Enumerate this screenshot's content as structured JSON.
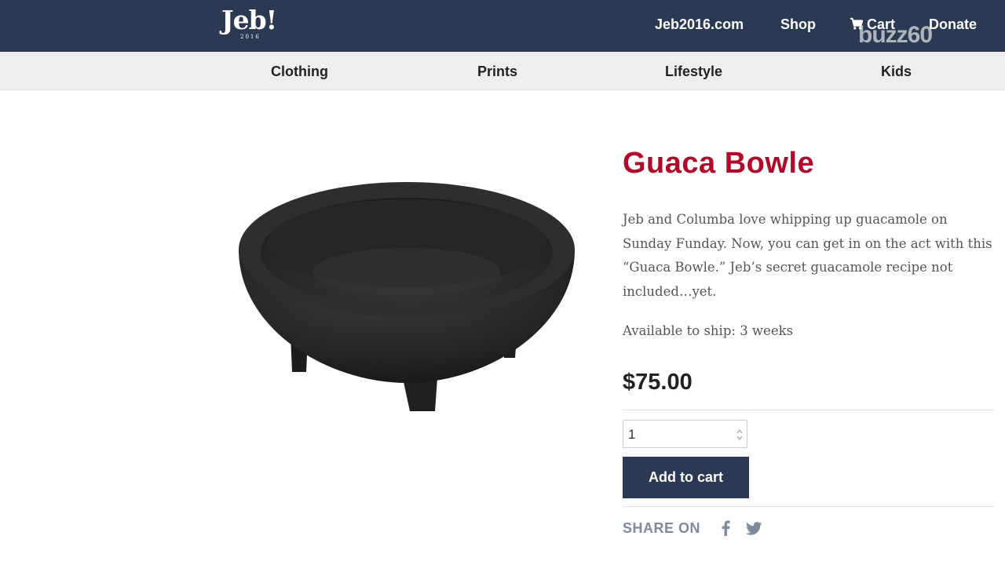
{
  "header": {
    "logo_text": "Jeb!",
    "logo_year": "2016",
    "links": {
      "site": "Jeb2016.com",
      "shop": "Shop",
      "cart": "Cart",
      "donate": "Donate"
    },
    "watermark": "buzz60"
  },
  "subnav": {
    "items": [
      "Clothing",
      "Prints",
      "Lifestyle",
      "Kids"
    ]
  },
  "product": {
    "title": "Guaca Bowle",
    "description": "Jeb and Columba love whipping up guacamole on Sunday Funday. Now, you can get in on the act with this “Guaca Bowle.” Jeb’s secret guacamole recipe not included…yet.",
    "availability": "Available to ship: 3 weeks",
    "price": "$75.00",
    "quantity": "1",
    "add_to_cart_label": "Add to cart",
    "share_label": "SHARE ON"
  },
  "icons": {
    "cart": "cart-icon",
    "facebook": "facebook-icon",
    "twitter": "twitter-icon",
    "spinner": "chevron-updown-icon"
  },
  "colors": {
    "header_bg": "#2b3a52",
    "subnav_bg": "#eeeeee",
    "title": "#b0092a",
    "button_bg": "#2b3a52",
    "share_text": "#7f8a9a"
  }
}
